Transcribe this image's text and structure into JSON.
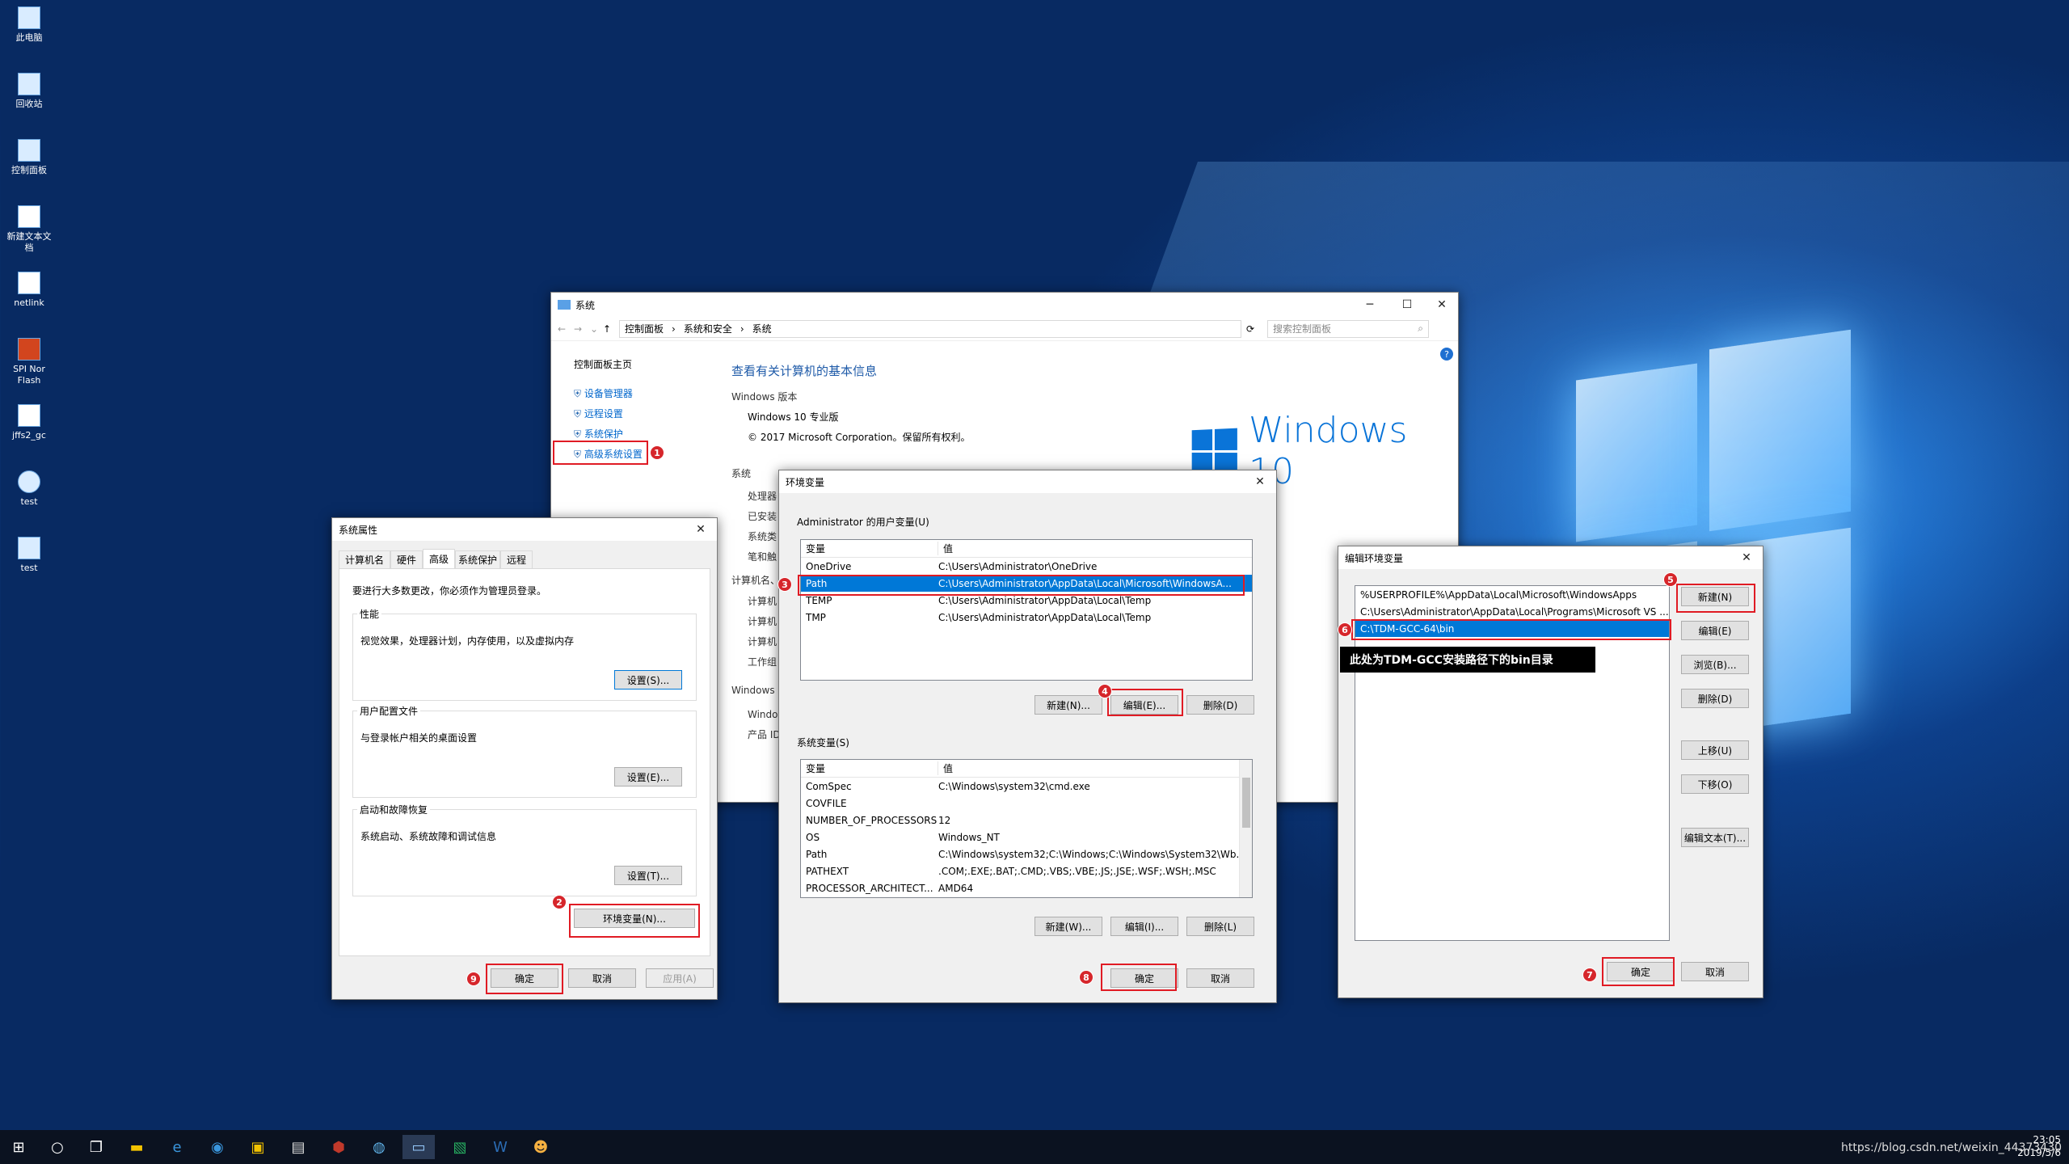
{
  "desktop": {
    "icons": [
      {
        "label": "此电脑",
        "icon": "computer-icon"
      },
      {
        "label": "回收站",
        "icon": "recycle-bin-icon"
      },
      {
        "label": "控制面板",
        "icon": "control-panel-icon"
      },
      {
        "label": "新建文本文档",
        "icon": "text-file-icon"
      },
      {
        "label": "netlink",
        "icon": "text-file-icon"
      },
      {
        "label": "SPI Nor Flash",
        "icon": "pdf-icon"
      },
      {
        "label": "jffs2_gc",
        "icon": "text-file-icon"
      },
      {
        "label": "test",
        "icon": "shortcut-icon"
      },
      {
        "label": "test",
        "icon": "shortcut-icon"
      }
    ]
  },
  "system_window": {
    "title": "系统",
    "breadcrumb": [
      "控制面板",
      "系统和安全",
      "系统"
    ],
    "search_placeholder": "搜索控制面板",
    "sidebar_home": "控制面板主页",
    "sidebar_links": [
      "设备管理器",
      "远程设置",
      "系统保护",
      "高级系统设置"
    ],
    "heading": "查看有关计算机的基本信息",
    "section_edition": "Windows 版本",
    "edition": "Windows 10 专业版",
    "copyright": "© 2017 Microsoft Corporation。保留所有权利。",
    "logo_text": "Windows 10",
    "section_system": "系统",
    "system_labels": [
      "处理器",
      "已安装",
      "系统类",
      "笔和触"
    ],
    "section_computer": "计算机名、",
    "computer_labels": [
      "计算机",
      "计算机",
      "计算机",
      "工作组"
    ],
    "section_windows": "Windows",
    "windows_labels": [
      "Windo",
      "产品 ID"
    ]
  },
  "sysprop_window": {
    "title": "系统属性",
    "tabs": [
      "计算机名",
      "硬件",
      "高级",
      "系统保护",
      "远程"
    ],
    "admin_note": "要进行大多数更改，你必须作为管理员登录。",
    "perf_title": "性能",
    "perf_desc": "视觉效果，处理器计划，内存使用，以及虚拟内存",
    "perf_btn": "设置(S)...",
    "profile_title": "用户配置文件",
    "profile_desc": "与登录帐户相关的桌面设置",
    "profile_btn": "设置(E)...",
    "startup_title": "启动和故障恢复",
    "startup_desc": "系统启动、系统故障和调试信息",
    "startup_btn": "设置(T)...",
    "env_btn": "环境变量(N)...",
    "ok": "确定",
    "cancel": "取消",
    "apply": "应用(A)"
  },
  "env_window": {
    "title": "环境变量",
    "user_group": "Administrator 的用户变量(U)",
    "col_var": "变量",
    "col_val": "值",
    "user_vars": [
      {
        "name": "OneDrive",
        "value": "C:\\Users\\Administrator\\OneDrive"
      },
      {
        "name": "Path",
        "value": "C:\\Users\\Administrator\\AppData\\Local\\Microsoft\\WindowsA..."
      },
      {
        "name": "TEMP",
        "value": "C:\\Users\\Administrator\\AppData\\Local\\Temp"
      },
      {
        "name": "TMP",
        "value": "C:\\Users\\Administrator\\AppData\\Local\\Temp"
      }
    ],
    "user_new": "新建(N)...",
    "user_edit": "编辑(E)...",
    "user_delete": "删除(D)",
    "sys_group": "系统变量(S)",
    "sys_vars": [
      {
        "name": "ComSpec",
        "value": "C:\\Windows\\system32\\cmd.exe"
      },
      {
        "name": "COVFILE",
        "value": ""
      },
      {
        "name": "NUMBER_OF_PROCESSORS",
        "value": "12"
      },
      {
        "name": "OS",
        "value": "Windows_NT"
      },
      {
        "name": "Path",
        "value": "C:\\Windows\\system32;C:\\Windows;C:\\Windows\\System32\\Wb..."
      },
      {
        "name": "PATHEXT",
        "value": ".COM;.EXE;.BAT;.CMD;.VBS;.VBE;.JS;.JSE;.WSF;.WSH;.MSC"
      },
      {
        "name": "PROCESSOR_ARCHITECT...",
        "value": "AMD64"
      }
    ],
    "sys_new": "新建(W)...",
    "sys_edit": "编辑(I)...",
    "sys_delete": "删除(L)",
    "ok": "确定",
    "cancel": "取消"
  },
  "edit_env_window": {
    "title": "编辑环境变量",
    "entries": [
      "%USERPROFILE%\\AppData\\Local\\Microsoft\\WindowsApps",
      "C:\\Users\\Administrator\\AppData\\Local\\Programs\\Microsoft VS ...",
      "C:\\TDM-GCC-64\\bin"
    ],
    "tooltip": "此处为TDM-GCC安装路径下的bin目录",
    "btn_new": "新建(N)",
    "btn_edit": "编辑(E)",
    "btn_browse": "浏览(B)...",
    "btn_delete": "删除(D)",
    "btn_up": "上移(U)",
    "btn_down": "下移(O)",
    "btn_edit_text": "编辑文本(T)...",
    "ok": "确定",
    "cancel": "取消"
  },
  "badges": [
    "1",
    "2",
    "3",
    "4",
    "5",
    "6",
    "7",
    "8",
    "9"
  ],
  "taskbar": {
    "watermark": "https://blog.csdn.net/weixin_44373430",
    "time": "23:05",
    "date": "2019/5/6"
  },
  "colors": {
    "accent": "#0078d7",
    "annotation": "#e01b24",
    "link": "#0066cc"
  }
}
